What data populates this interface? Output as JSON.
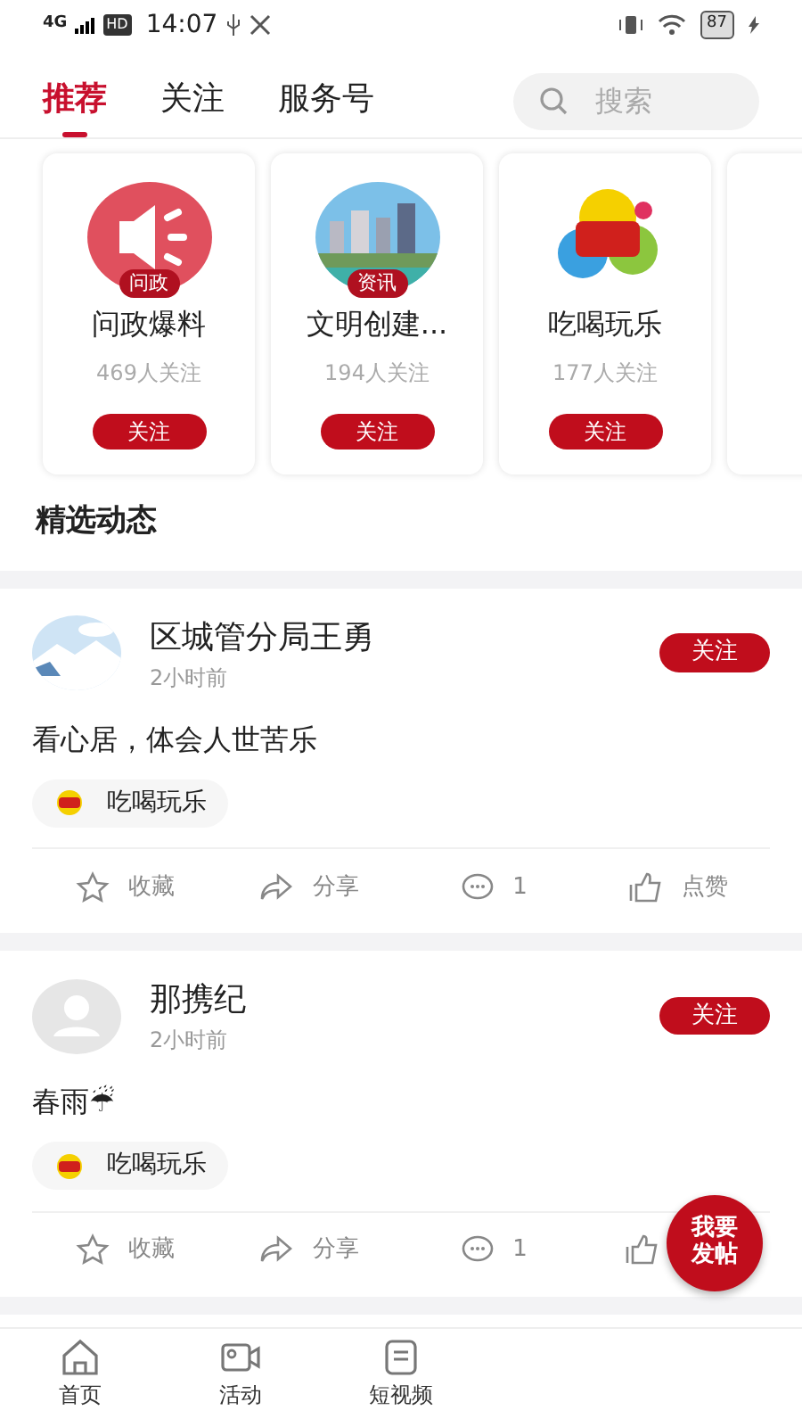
{
  "status_bar": {
    "network": "4G",
    "hd": "HD",
    "time": "14:07",
    "battery": "87"
  },
  "tabs": [
    {
      "label": "推荐",
      "selected": true
    },
    {
      "label": "关注",
      "selected": false
    },
    {
      "label": "服务号",
      "selected": false
    }
  ],
  "search": {
    "placeholder": "搜索"
  },
  "channels": [
    {
      "kind": "speaker",
      "badge": "问政",
      "name": "问政爆料",
      "followers": "469人关注",
      "button": "关注"
    },
    {
      "kind": "city",
      "badge": "资讯",
      "name": "文明创建...",
      "followers": "194人关注",
      "button": "关注"
    },
    {
      "kind": "food",
      "name": "吃喝玩乐",
      "followers": "177人关注",
      "button": "关注"
    },
    {
      "kind": "partial"
    }
  ],
  "section_title": "精选动态",
  "posts": [
    {
      "author": "区城管分局王勇",
      "time": "2小时前",
      "follow": "关注",
      "text": "看心居，体会人世苦乐",
      "topic": "吃喝玩乐",
      "actions": [
        "收藏",
        "分享",
        "1",
        "点赞"
      ]
    },
    {
      "kind": "default",
      "author": "那携纪",
      "time": "2小时前",
      "follow": "关注",
      "text": "春雨☔",
      "topic": "吃喝玩乐",
      "actions": [
        "收藏",
        "分享",
        "1"
      ]
    }
  ],
  "fab": "我要发帖",
  "bottom_nav": [
    {
      "kind": "home",
      "label": "首页"
    },
    {
      "kind": "camera",
      "label": "活动"
    },
    {
      "kind": "note",
      "label": "短视频"
    }
  ]
}
